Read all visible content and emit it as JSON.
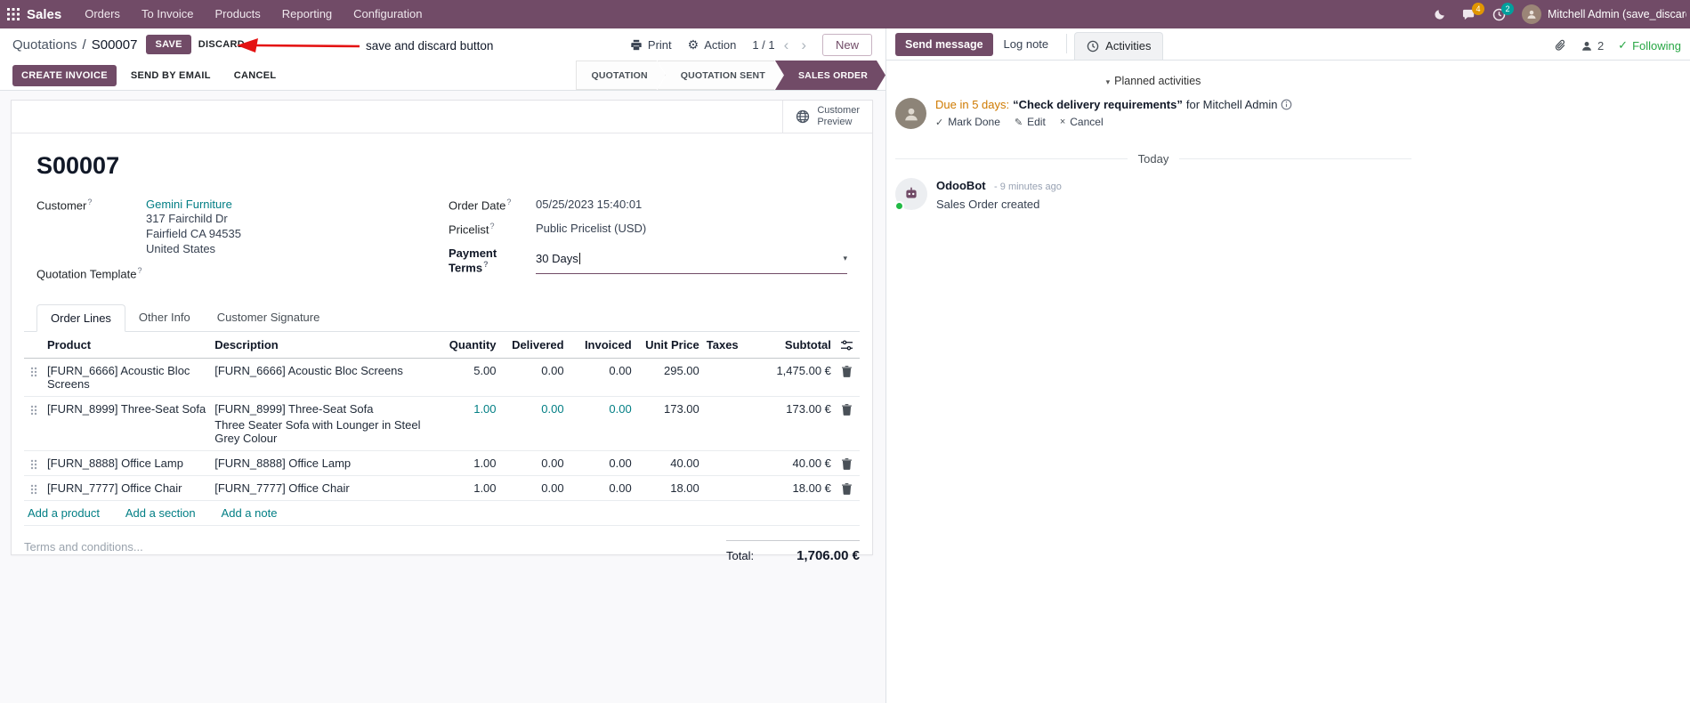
{
  "icons": {
    "caret_down": "▾",
    "chevron_left": "‹",
    "chevron_right": "›",
    "check": "✓",
    "pencil": "✎",
    "cross": "×",
    "gear": "⚙",
    "help": "?",
    "separator": "/"
  },
  "navbar": {
    "app_name": "Sales",
    "menus": [
      "Orders",
      "To Invoice",
      "Products",
      "Reporting",
      "Configuration"
    ],
    "messages_badge": "4",
    "activities_badge": "2",
    "user_name": "Mitchell Admin (save_discard"
  },
  "breadcrumb": {
    "parent": "Quotations",
    "current": "S00007",
    "save_label": "SAVE",
    "discard_label": "DISCARD"
  },
  "annotation": {
    "text": "save and discard button"
  },
  "control_panel": {
    "print_label": "Print",
    "action_label": "Action",
    "pager": "1 / 1",
    "new_label": "New"
  },
  "statusbar": {
    "create_invoice": "CREATE INVOICE",
    "send_by_email": "SEND BY EMAIL",
    "cancel": "CANCEL",
    "stages": [
      {
        "label": "QUOTATION"
      },
      {
        "label": "QUOTATION SENT"
      },
      {
        "label": "SALES ORDER"
      }
    ]
  },
  "sheet": {
    "customer_preview_line1": "Customer",
    "customer_preview_line2": "Preview",
    "title": "S00007",
    "fields": {
      "customer_label": "Customer",
      "customer_value": "Gemini Furniture",
      "address": [
        "317 Fairchild Dr",
        "Fairfield CA 94535",
        "United States"
      ],
      "quotation_template_label": "Quotation Template",
      "order_date_label": "Order Date",
      "order_date_value": "05/25/2023 15:40:01",
      "pricelist_label": "Pricelist",
      "pricelist_value": "Public Pricelist (USD)",
      "payment_terms_label": "Payment Terms",
      "payment_terms_value": "30 Days"
    },
    "tabs": [
      {
        "label": "Order Lines"
      },
      {
        "label": "Other Info"
      },
      {
        "label": "Customer Signature"
      }
    ],
    "table": {
      "headers": [
        "Product",
        "Description",
        "Quantity",
        "Delivered",
        "Invoiced",
        "Unit Price",
        "Taxes",
        "Subtotal"
      ],
      "rows": [
        {
          "product": "[FURN_6666] Acoustic Bloc Screens",
          "description": "[FURN_6666] Acoustic Bloc Screens",
          "description2": "",
          "quantity": "5.00",
          "delivered": "0.00",
          "invoiced": "0.00",
          "unit_price": "295.00",
          "taxes": "",
          "subtotal": "1,475.00 €"
        },
        {
          "product": "[FURN_8999] Three-Seat Sofa",
          "description": "[FURN_8999] Three-Seat Sofa",
          "description2": "Three Seater Sofa with Lounger in Steel Grey Colour",
          "quantity": "1.00",
          "delivered": "0.00",
          "invoiced": "0.00",
          "unit_price": "173.00",
          "taxes": "",
          "subtotal": "173.00 €"
        },
        {
          "product": "[FURN_8888] Office Lamp",
          "description": "[FURN_8888] Office Lamp",
          "description2": "",
          "quantity": "1.00",
          "delivered": "0.00",
          "invoiced": "0.00",
          "unit_price": "40.00",
          "taxes": "",
          "subtotal": "40.00 €"
        },
        {
          "product": "[FURN_7777] Office Chair",
          "description": "[FURN_7777] Office Chair",
          "description2": "",
          "quantity": "1.00",
          "delivered": "0.00",
          "invoiced": "0.00",
          "unit_price": "18.00",
          "taxes": "",
          "subtotal": "18.00 €"
        }
      ],
      "footer_links": [
        "Add a product",
        "Add a section",
        "Add a note"
      ]
    },
    "terms_placeholder": "Terms and conditions...",
    "total_label": "Total:",
    "total_value": "1,706.00 €"
  },
  "chatter": {
    "send_message": "Send message",
    "log_note": "Log note",
    "activities": "Activities",
    "followers_count": "2",
    "following": "Following",
    "planned_activities": "Planned activities",
    "activity": {
      "due": "Due in 5 days:",
      "summary": "“Check delivery requirements”",
      "for_text": "for Mitchell Admin",
      "mark_done": "Mark Done",
      "edit": "Edit",
      "cancel": "Cancel"
    },
    "today": "Today",
    "message": {
      "author": "OdooBot",
      "time": "- 9 minutes ago",
      "body": "Sales Order created"
    }
  }
}
